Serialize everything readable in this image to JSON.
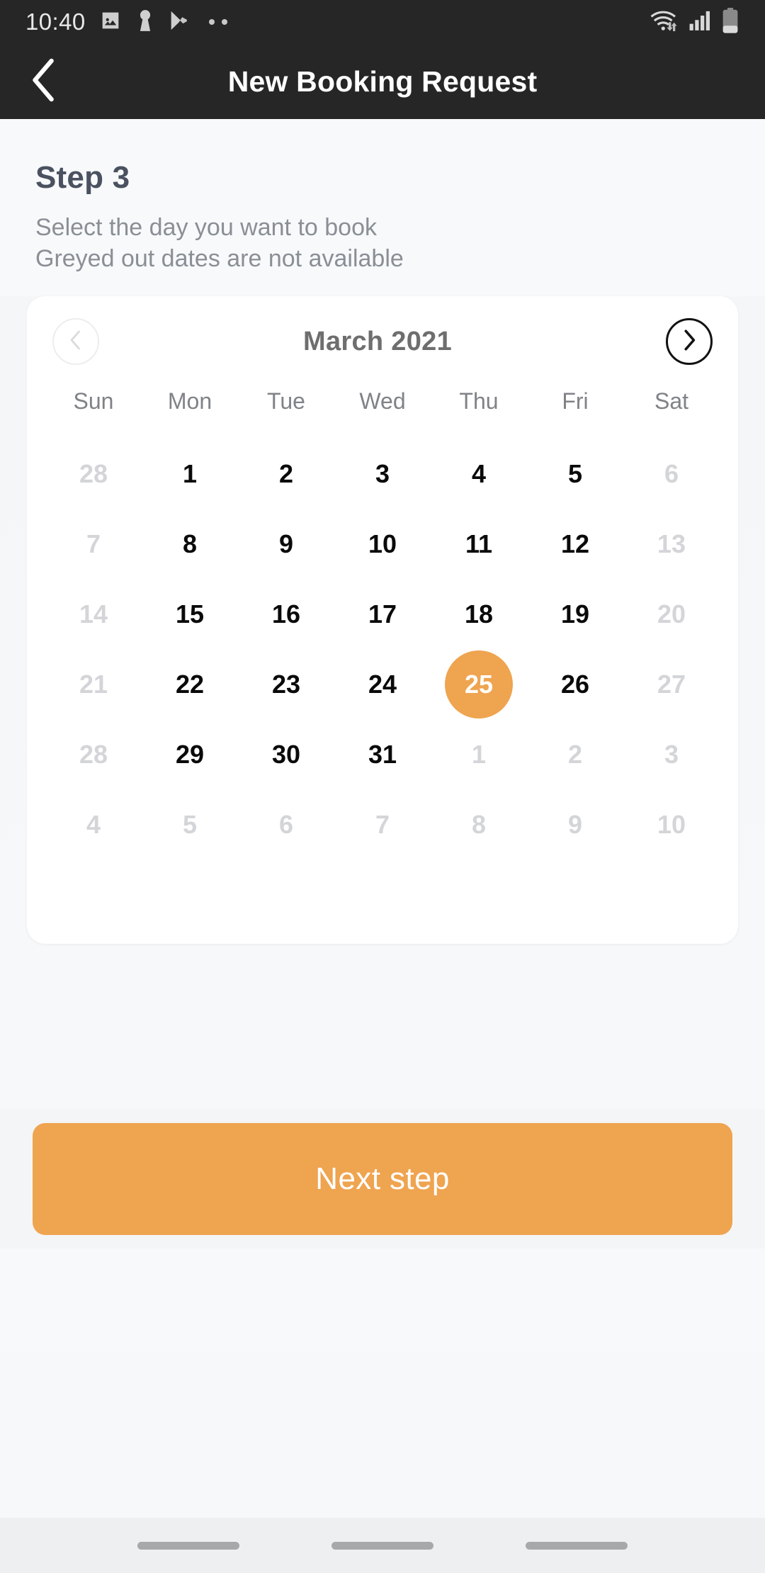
{
  "status_bar": {
    "time": "10:40",
    "left_icons": [
      "gallery-image-icon",
      "keyhole-icon",
      "play-store-icon",
      "more-notifications-dots-icon"
    ],
    "right_icons": [
      "wifi-icon",
      "cellular-signal-icon",
      "battery-icon"
    ],
    "background_color": "#262626"
  },
  "app_bar": {
    "back_icon": "chevron-left-icon",
    "title": "New Booking Request"
  },
  "intro": {
    "step_title": "Step 3",
    "subtitle_line_1": "Select the day you want to book",
    "subtitle_line_2": "Greyed out dates are not available"
  },
  "calendar": {
    "month_label": "March 2021",
    "prev_icon": "chevron-left-icon",
    "next_icon": "chevron-right-icon",
    "prev_enabled": false,
    "next_enabled": true,
    "weekdays": [
      "Sun",
      "Mon",
      "Tue",
      "Wed",
      "Thu",
      "Fri",
      "Sat"
    ],
    "selected_day": "25",
    "selected_color": "#EFA450",
    "weeks": [
      [
        {
          "label": "28",
          "state": "muted"
        },
        {
          "label": "1",
          "state": "active"
        },
        {
          "label": "2",
          "state": "active"
        },
        {
          "label": "3",
          "state": "active"
        },
        {
          "label": "4",
          "state": "active"
        },
        {
          "label": "5",
          "state": "active"
        },
        {
          "label": "6",
          "state": "muted"
        }
      ],
      [
        {
          "label": "7",
          "state": "muted"
        },
        {
          "label": "8",
          "state": "active"
        },
        {
          "label": "9",
          "state": "active"
        },
        {
          "label": "10",
          "state": "active"
        },
        {
          "label": "11",
          "state": "active"
        },
        {
          "label": "12",
          "state": "active"
        },
        {
          "label": "13",
          "state": "muted"
        }
      ],
      [
        {
          "label": "14",
          "state": "muted"
        },
        {
          "label": "15",
          "state": "active"
        },
        {
          "label": "16",
          "state": "active"
        },
        {
          "label": "17",
          "state": "active"
        },
        {
          "label": "18",
          "state": "active"
        },
        {
          "label": "19",
          "state": "active"
        },
        {
          "label": "20",
          "state": "muted"
        }
      ],
      [
        {
          "label": "21",
          "state": "muted"
        },
        {
          "label": "22",
          "state": "active"
        },
        {
          "label": "23",
          "state": "active"
        },
        {
          "label": "24",
          "state": "active"
        },
        {
          "label": "25",
          "state": "selected"
        },
        {
          "label": "26",
          "state": "active"
        },
        {
          "label": "27",
          "state": "muted"
        }
      ],
      [
        {
          "label": "28",
          "state": "muted"
        },
        {
          "label": "29",
          "state": "active"
        },
        {
          "label": "30",
          "state": "active"
        },
        {
          "label": "31",
          "state": "active"
        },
        {
          "label": "1",
          "state": "muted"
        },
        {
          "label": "2",
          "state": "muted"
        },
        {
          "label": "3",
          "state": "muted"
        }
      ],
      [
        {
          "label": "4",
          "state": "muted"
        },
        {
          "label": "5",
          "state": "muted"
        },
        {
          "label": "6",
          "state": "muted"
        },
        {
          "label": "7",
          "state": "muted"
        },
        {
          "label": "8",
          "state": "muted"
        },
        {
          "label": "9",
          "state": "muted"
        },
        {
          "label": "10",
          "state": "muted"
        }
      ]
    ]
  },
  "footer": {
    "next_label": "Next step",
    "next_color": "#EFA450"
  },
  "nav_bar": {
    "items": [
      "recents-pill",
      "home-pill",
      "back-pill"
    ]
  }
}
